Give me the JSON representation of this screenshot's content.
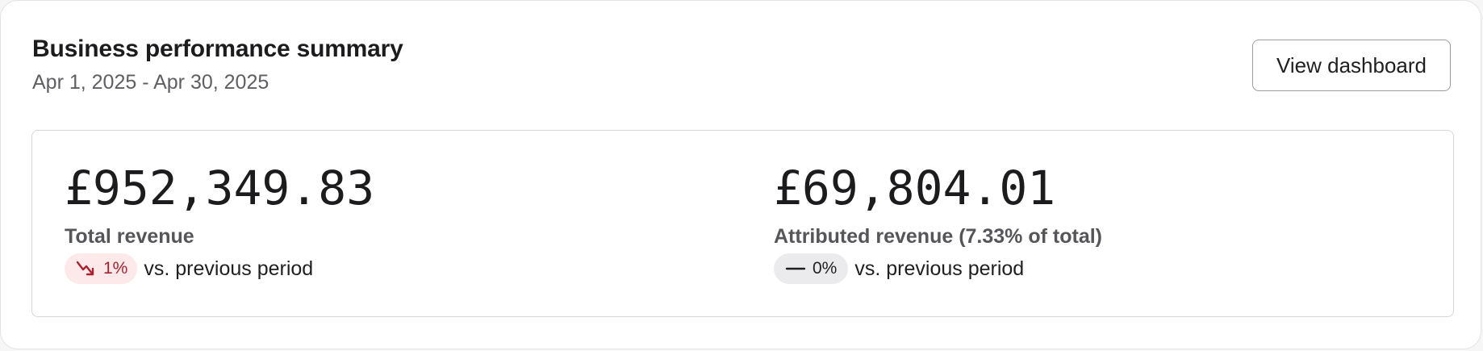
{
  "header": {
    "title": "Business performance summary",
    "date_range": "Apr 1, 2025 - Apr 30, 2025",
    "view_button_label": "View dashboard"
  },
  "metrics": [
    {
      "value": "£952,349.83",
      "label": "Total revenue",
      "change": "1%",
      "change_direction": "down",
      "change_icon": "trending-down-icon",
      "comparison_text": "vs. previous period"
    },
    {
      "value": "£69,804.01",
      "label": "Attributed revenue (7.33% of total)",
      "change": "0%",
      "change_direction": "flat",
      "change_icon": "dash-icon",
      "comparison_text": "vs. previous period"
    }
  ],
  "colors": {
    "negative_badge_bg": "#fde8ea",
    "negative_badge_text": "#a8232f",
    "neutral_badge_bg": "#ebebed"
  }
}
